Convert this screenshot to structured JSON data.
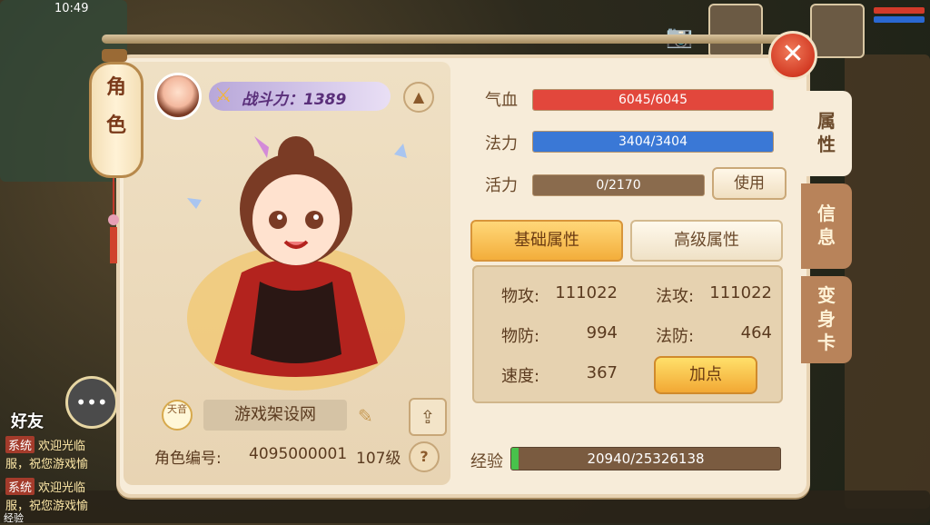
{
  "status": {
    "time": "10:49"
  },
  "left_chat": {
    "friend_label": "好友",
    "badge": "-5-",
    "messages": [
      {
        "tag": "系统",
        "text": "欢迎光临"
      },
      {
        "tag": "",
        "text": "服，祝您游戏愉"
      },
      {
        "tag": "系统",
        "text": "欢迎光临"
      },
      {
        "tag": "",
        "text": "服，祝您游戏愉"
      }
    ],
    "bottom_label": "经验"
  },
  "panel": {
    "lantern_text": [
      "角",
      "色"
    ],
    "power_label": "战斗力：1389",
    "name": "游戏架设网",
    "badge_text": "天音",
    "role_id_label": "角色编号:",
    "role_id": "4095000001",
    "level": "107级",
    "help": "?",
    "close": "✕"
  },
  "stats": {
    "hp": {
      "label": "气血",
      "text": "6045/6045",
      "fraction": 1.0,
      "color": "#e2473c"
    },
    "mp": {
      "label": "法力",
      "text": "3404/3404",
      "fraction": 1.0,
      "color": "#3a78d6"
    },
    "vigor": {
      "label": "活力",
      "text": "0/2170",
      "fraction": 0.0,
      "color": "#8a6b4d"
    },
    "use_button": "使用",
    "tabs": {
      "basic": "基础属性",
      "advanced": "高级属性"
    },
    "attributes": [
      {
        "label": "物攻:",
        "value": "111022"
      },
      {
        "label": "法攻:",
        "value": "111022"
      },
      {
        "label": "物防:",
        "value": "994"
      },
      {
        "label": "法防:",
        "value": "464"
      },
      {
        "label": "速度:",
        "value": "367"
      }
    ],
    "add_point_button": "加点",
    "exp": {
      "label": "经验",
      "text": "20940/25326138",
      "fraction": 0.0008
    }
  },
  "side_tabs": [
    {
      "label": "属\n性"
    },
    {
      "label": "信\n息"
    },
    {
      "label": "变\n身\n卡"
    }
  ]
}
